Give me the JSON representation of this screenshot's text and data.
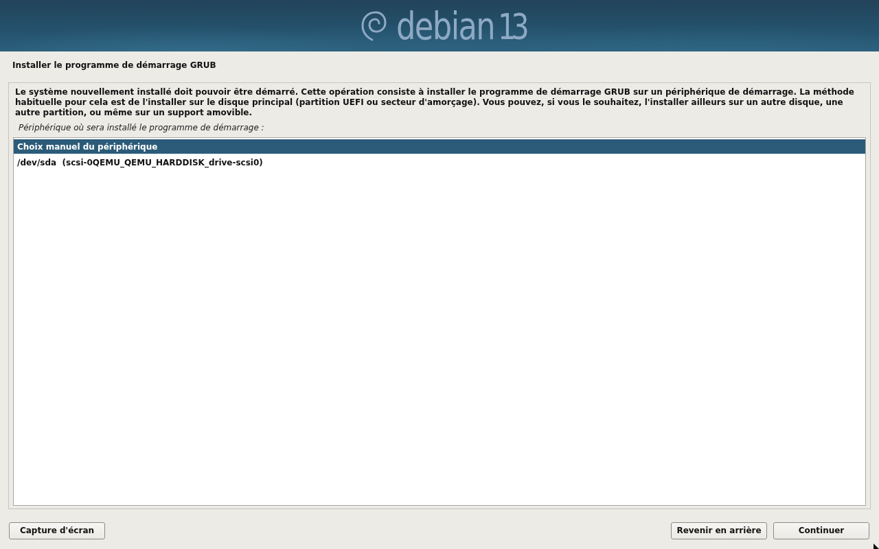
{
  "banner": {
    "logo_word": "debian",
    "logo_version": "13"
  },
  "page_title": "Installer le programme de démarrage GRUB",
  "description": "Le système nouvellement installé doit pouvoir être démarré. Cette opération consiste à installer le programme de démarrage GRUB sur un périphérique de démarrage. La méthode habituelle pour cela est de l'installer sur le disque principal (partition UEFI ou secteur d'amorçage). Vous pouvez, si vous le souhaitez, l'installer ailleurs sur un autre disque, une autre partition, ou même sur un support amovible.",
  "list_label": "Périphérique où sera installé le programme de démarrage :",
  "devices": [
    {
      "label": "Choix manuel du périphérique",
      "selected": true
    },
    {
      "label": "/dev/sda  (scsi-0QEMU_QEMU_HARDDISK_drive-scsi0)",
      "selected": false
    }
  ],
  "left_buttons": [
    "Capture d'écran"
  ],
  "right_buttons": [
    "Revenir en arrière",
    "Continuer"
  ]
}
